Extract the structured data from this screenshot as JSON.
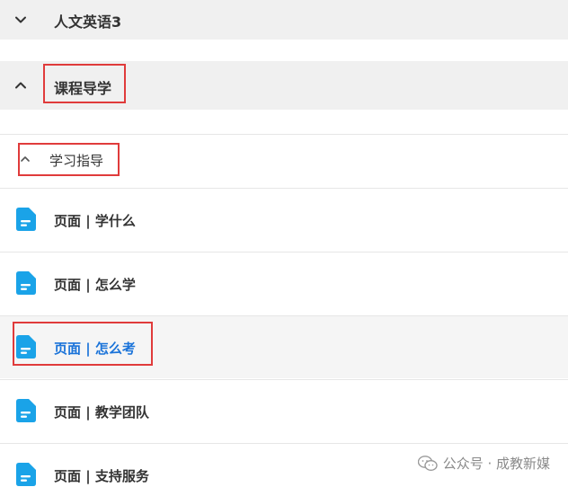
{
  "sections": {
    "previous": {
      "title": "人文英语3",
      "expanded": false
    },
    "course_guide": {
      "title": "课程导学",
      "expanded": true
    }
  },
  "subsection": {
    "title": "学习指导",
    "expanded": true
  },
  "items": [
    {
      "label": "页面 | 学什么",
      "icon": "document-icon",
      "active": false
    },
    {
      "label": "页面 | 怎么学",
      "icon": "document-icon",
      "active": false
    },
    {
      "label": "页面 | 怎么考",
      "icon": "document-icon",
      "active": true
    },
    {
      "label": "页面 | 教学团队",
      "icon": "document-icon",
      "active": false
    },
    {
      "label": "页面 | 支持服务",
      "icon": "document-icon",
      "active": false
    }
  ],
  "watermark": {
    "text": "公众号 · 成教新媒"
  },
  "colors": {
    "accent": "#1a73d9",
    "icon": "#1aa3e8",
    "highlight_box": "#e03b3b",
    "section_bg": "#f0f0f0"
  }
}
